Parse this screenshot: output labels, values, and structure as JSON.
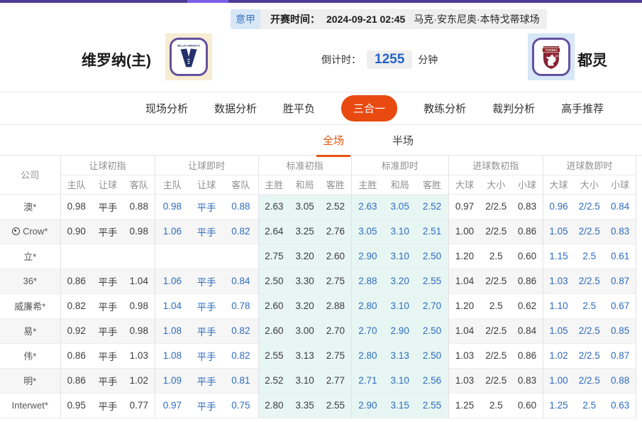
{
  "top_bar": {
    "color": "#4d3c94",
    "accent_segment_color": "#7a5ee8"
  },
  "match_header": {
    "league_badge": "意甲",
    "kickoff_label": "开赛时间：",
    "kickoff_time": "2024-09-21 02:45",
    "venue": "马克·安东尼奥·本特戈蒂球场",
    "countdown_label": "倒计时：",
    "countdown_value": "1255",
    "countdown_unit": "分钟",
    "home_team": {
      "name": "维罗纳(主)",
      "crest_text": "HELLAS VERONA FC"
    },
    "away_team": {
      "name": "都灵",
      "crest_text": "TORINO",
      "crest_fc": "FC"
    }
  },
  "nav": {
    "tabs": [
      {
        "label": "现场分析",
        "active": false
      },
      {
        "label": "数据分析",
        "active": false
      },
      {
        "label": "胜平负",
        "active": false
      },
      {
        "label": "三合一",
        "active": true
      },
      {
        "label": "教练分析",
        "active": false
      },
      {
        "label": "裁判分析",
        "active": false
      },
      {
        "label": "高手推荐",
        "active": false
      }
    ]
  },
  "period_tabs": [
    {
      "label": "全场",
      "active": true
    },
    {
      "label": "半场",
      "active": false
    }
  ],
  "odds_table": {
    "company_header": "公司",
    "groups": [
      {
        "label": "让球初指",
        "sub": [
          "主队",
          "让球",
          "客队"
        ],
        "cyan": false,
        "live": false
      },
      {
        "label": "让球即时",
        "sub": [
          "主队",
          "让球",
          "客队"
        ],
        "cyan": false,
        "live": true
      },
      {
        "label": "标准初指",
        "sub": [
          "主胜",
          "和局",
          "客胜"
        ],
        "cyan": true,
        "live": false
      },
      {
        "label": "标准即时",
        "sub": [
          "主胜",
          "和局",
          "客胜"
        ],
        "cyan": true,
        "live": true
      },
      {
        "label": "进球数初指",
        "sub": [
          "大球",
          "大小",
          "小球"
        ],
        "cyan": false,
        "live": false
      },
      {
        "label": "进球数即时",
        "sub": [
          "大球",
          "大小",
          "小球"
        ],
        "cyan": false,
        "live": true
      }
    ],
    "rows": [
      {
        "company": "澳*",
        "has_icon": false,
        "cells": [
          [
            "0.98",
            "平手",
            "0.88"
          ],
          [
            "0.98",
            "平手",
            "0.88"
          ],
          [
            "2.63",
            "3.05",
            "2.52"
          ],
          [
            "2.63",
            "3.05",
            "2.52"
          ],
          [
            "0.97",
            "2/2.5",
            "0.83"
          ],
          [
            "0.96",
            "2/2.5",
            "0.84"
          ]
        ]
      },
      {
        "company": "Crow*",
        "has_icon": true,
        "cells": [
          [
            "0.90",
            "平手",
            "0.98"
          ],
          [
            "1.06",
            "平手",
            "0.82"
          ],
          [
            "2.64",
            "3.25",
            "2.76"
          ],
          [
            "3.05",
            "3.10",
            "2.51"
          ],
          [
            "1.00",
            "2/2.5",
            "0.86"
          ],
          [
            "1.05",
            "2/2.5",
            "0.83"
          ]
        ]
      },
      {
        "company": "立*",
        "has_icon": false,
        "cells": [
          [
            "",
            "",
            ""
          ],
          [
            "",
            "",
            ""
          ],
          [
            "2.75",
            "3.20",
            "2.60"
          ],
          [
            "2.90",
            "3.10",
            "2.50"
          ],
          [
            "1.20",
            "2.5",
            "0.60"
          ],
          [
            "1.15",
            "2.5",
            "0.61"
          ]
        ]
      },
      {
        "company": "36*",
        "has_icon": false,
        "cells": [
          [
            "0.86",
            "平手",
            "1.04"
          ],
          [
            "1.06",
            "平手",
            "0.84"
          ],
          [
            "2.50",
            "3.30",
            "2.75"
          ],
          [
            "2.88",
            "3.20",
            "2.55"
          ],
          [
            "1.04",
            "2/2.5",
            "0.86"
          ],
          [
            "1.03",
            "2/2.5",
            "0.87"
          ]
        ]
      },
      {
        "company": "威廉希*",
        "has_icon": false,
        "cells": [
          [
            "0.82",
            "平手",
            "0.98"
          ],
          [
            "1.04",
            "平手",
            "0.78"
          ],
          [
            "2.60",
            "3.20",
            "2.88"
          ],
          [
            "2.80",
            "3.10",
            "2.70"
          ],
          [
            "1.20",
            "2.5",
            "0.62"
          ],
          [
            "1.10",
            "2.5",
            "0.67"
          ]
        ]
      },
      {
        "company": "易*",
        "has_icon": false,
        "cells": [
          [
            "0.92",
            "平手",
            "0.98"
          ],
          [
            "1.08",
            "平手",
            "0.82"
          ],
          [
            "2.60",
            "3.00",
            "2.70"
          ],
          [
            "2.70",
            "2.90",
            "2.50"
          ],
          [
            "1.04",
            "2/2.5",
            "0.84"
          ],
          [
            "1.05",
            "2/2.5",
            "0.85"
          ]
        ]
      },
      {
        "company": "伟*",
        "has_icon": false,
        "cells": [
          [
            "0.86",
            "平手",
            "1.03"
          ],
          [
            "1.08",
            "平手",
            "0.82"
          ],
          [
            "2.55",
            "3.13",
            "2.75"
          ],
          [
            "2.80",
            "3.13",
            "2.50"
          ],
          [
            "1.03",
            "2/2.5",
            "0.86"
          ],
          [
            "1.02",
            "2/2.5",
            "0.87"
          ]
        ]
      },
      {
        "company": "明*",
        "has_icon": false,
        "cells": [
          [
            "0.86",
            "平手",
            "1.02"
          ],
          [
            "1.09",
            "平手",
            "0.81"
          ],
          [
            "2.52",
            "3.10",
            "2.77"
          ],
          [
            "2.71",
            "3.10",
            "2.56"
          ],
          [
            "1.03",
            "2/2.5",
            "0.83"
          ],
          [
            "1.00",
            "2/2.5",
            "0.88"
          ]
        ]
      },
      {
        "company": "Interwet*",
        "has_icon": false,
        "cells": [
          [
            "0.95",
            "平手",
            "0.77"
          ],
          [
            "0.97",
            "平手",
            "0.75"
          ],
          [
            "2.80",
            "3.35",
            "2.55"
          ],
          [
            "2.90",
            "3.15",
            "2.55"
          ],
          [
            "1.25",
            "2.5",
            "0.60"
          ],
          [
            "1.25",
            "2.5",
            "0.63"
          ]
        ]
      }
    ]
  },
  "colors": {
    "accent_orange": "#e84a10",
    "subtab_orange": "#e8540f",
    "live_link_blue": "#2e6cc0",
    "countdown_blue": "#2563c4",
    "cyan_column_bg": "#e7f6f3",
    "league_badge_bg": "#d8e7f6",
    "league_badge_text": "#3d77bb"
  }
}
